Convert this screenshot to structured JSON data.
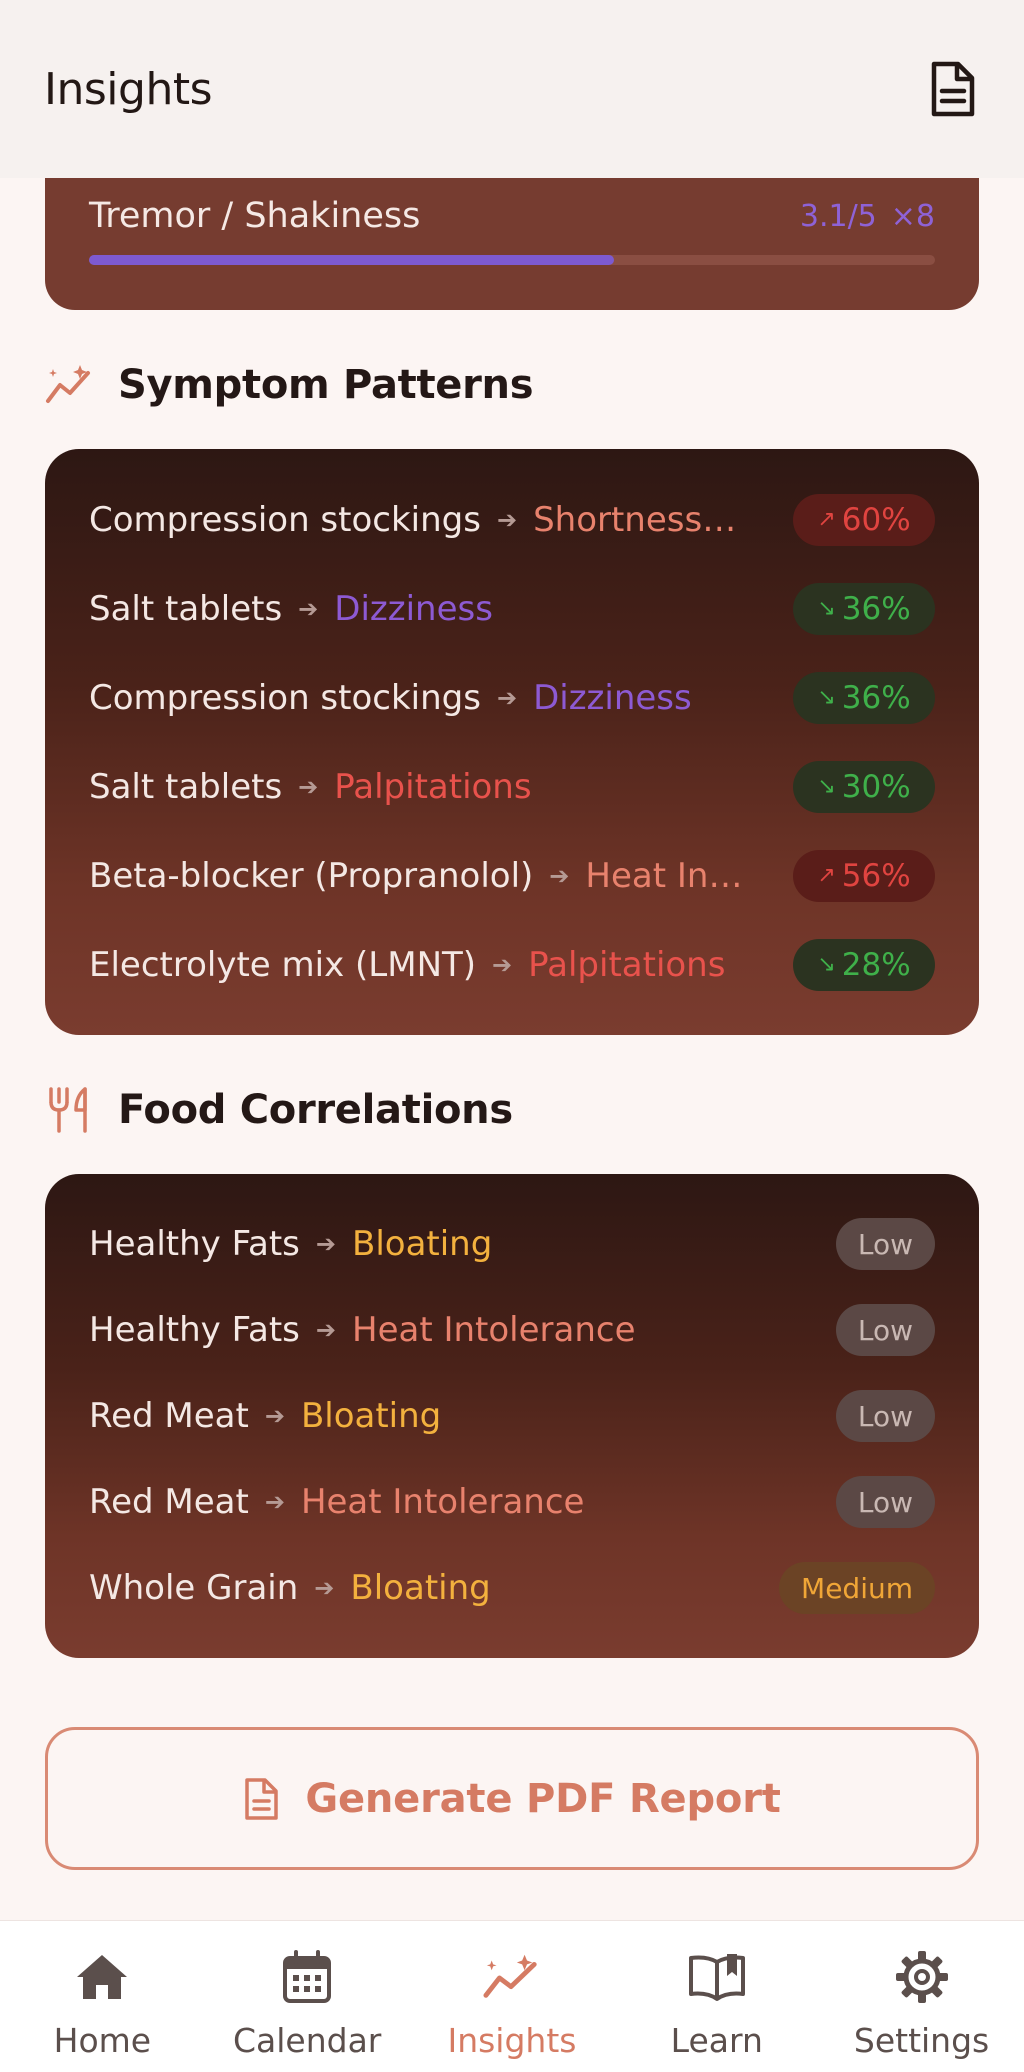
{
  "header": {
    "title": "Insights",
    "doc_icon": "document-icon"
  },
  "tremor": {
    "label": "Tremor / Shakiness",
    "score": "3.1/5",
    "count": "×8",
    "level_fraction": 0.62,
    "accent": "#8e62d6"
  },
  "symptom_patterns": {
    "title": "Symptom Patterns",
    "icon": "trend-sparkle-icon",
    "rows": [
      {
        "medication": "Compression stockings",
        "symptom": "Shortness of breath",
        "symptom_color": "#e8826d",
        "value": "60%",
        "trend": "up"
      },
      {
        "medication": "Salt tablets",
        "symptom": "Dizziness",
        "symptom_color": "#8d5ad3",
        "value": "36%",
        "trend": "down"
      },
      {
        "medication": "Compression stockings",
        "symptom": "Dizziness",
        "symptom_color": "#8d5ad3",
        "value": "36%",
        "trend": "down"
      },
      {
        "medication": "Salt tablets",
        "symptom": "Palpitations",
        "symptom_color": "#e8524c",
        "value": "30%",
        "trend": "down"
      },
      {
        "medication": "Beta-blocker (Propranolol)",
        "symptom": "Heat Intolerance",
        "symptom_color": "#e8826d",
        "value": "56%",
        "trend": "up"
      },
      {
        "medication": "Electrolyte mix (LMNT)",
        "symptom": "Palpitations",
        "symptom_color": "#e8524c",
        "value": "28%",
        "trend": "down"
      }
    ]
  },
  "food_correlations": {
    "title": "Food Correlations",
    "icon": "fork-knife-icon",
    "rows": [
      {
        "food": "Healthy Fats",
        "symptom": "Bloating",
        "symptom_color": "#f3b13e",
        "level": "Low"
      },
      {
        "food": "Healthy Fats",
        "symptom": "Heat Intolerance",
        "symptom_color": "#e8826d",
        "level": "Low"
      },
      {
        "food": "Red Meat",
        "symptom": "Bloating",
        "symptom_color": "#f3b13e",
        "level": "Low"
      },
      {
        "food": "Red Meat",
        "symptom": "Heat Intolerance",
        "symptom_color": "#e8826d",
        "level": "Low"
      },
      {
        "food": "Whole Grain",
        "symptom": "Bloating",
        "symptom_color": "#f3b13e",
        "level": "Medium"
      }
    ]
  },
  "pdf_button": {
    "label": "Generate PDF Report",
    "icon": "document-icon"
  },
  "nav": {
    "items": [
      {
        "label": "Home",
        "icon": "home-icon"
      },
      {
        "label": "Calendar",
        "icon": "calendar-icon"
      },
      {
        "label": "Insights",
        "icon": "insights-icon",
        "active": true
      },
      {
        "label": "Learn",
        "icon": "book-icon"
      },
      {
        "label": "Settings",
        "icon": "gear-icon"
      }
    ]
  },
  "colors": {
    "accent": "#d57b63",
    "trend_up": "#e04440",
    "trend_down": "#3fb04a",
    "card_dark": "#2d1713",
    "card_light": "#7a3c2f"
  }
}
